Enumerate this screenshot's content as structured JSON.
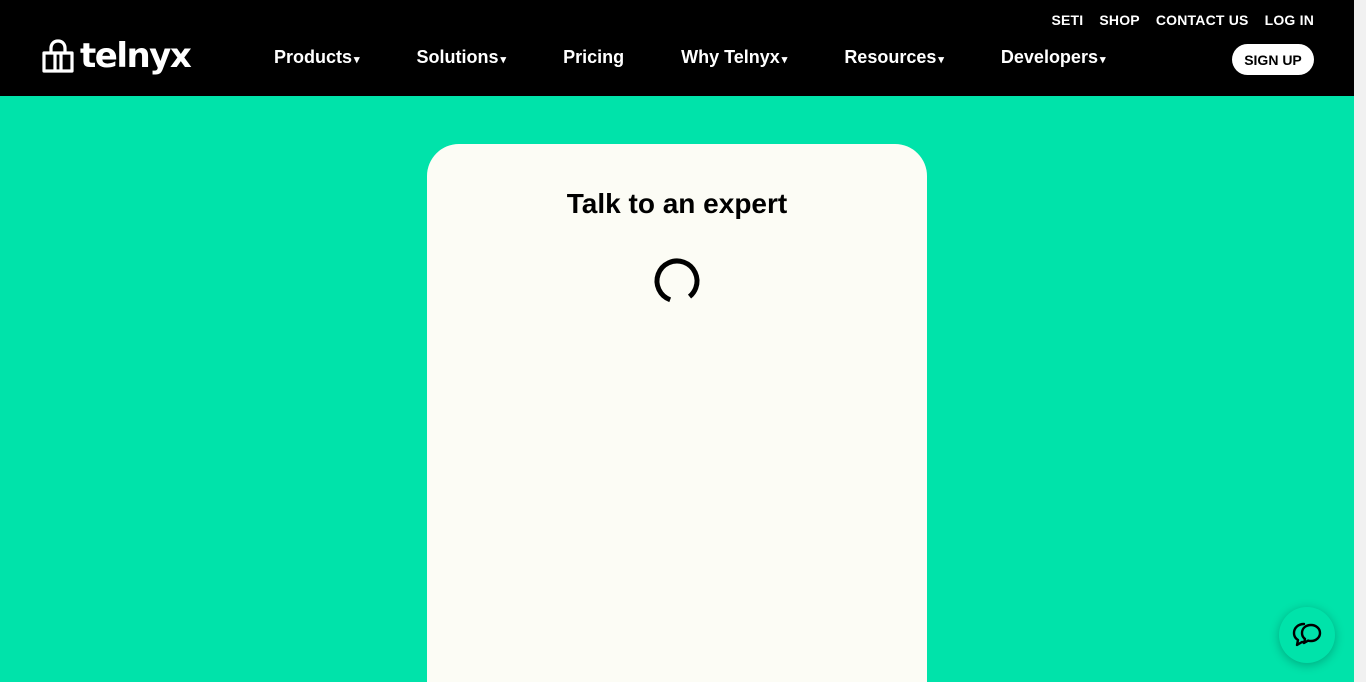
{
  "header": {
    "logo_text": "telnyx",
    "utility_links": [
      "SETI",
      "SHOP",
      "CONTACT US",
      "LOG IN"
    ],
    "nav_items": [
      {
        "label": "Products",
        "dropdown": true
      },
      {
        "label": "Solutions",
        "dropdown": true
      },
      {
        "label": "Pricing",
        "dropdown": false
      },
      {
        "label": "Why Telnyx",
        "dropdown": true
      },
      {
        "label": "Resources",
        "dropdown": true
      },
      {
        "label": "Developers",
        "dropdown": true
      }
    ],
    "signup_label": "SIGN UP",
    "caret": "▾"
  },
  "card": {
    "title": "Talk to an expert"
  },
  "icons": {
    "logo": "telnyx-logo-icon",
    "spinner": "loading-spinner-icon",
    "chat": "chat-bubbles-icon"
  },
  "colors": {
    "background": "#00e3aa",
    "header": "#000000",
    "card": "#fcfcf5"
  }
}
